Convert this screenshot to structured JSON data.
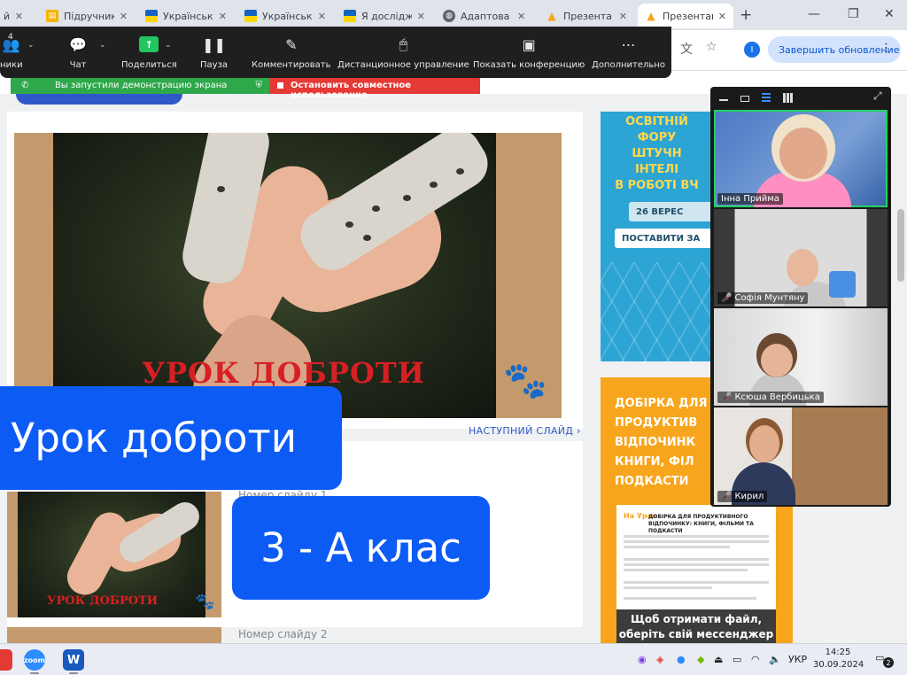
{
  "browser": {
    "tabs": [
      {
        "title": "й",
        "icon": "document-icon",
        "active": false
      },
      {
        "title": "Підручник",
        "icon": "book-icon",
        "active": false
      },
      {
        "title": "Українськ",
        "icon": "ukraine-flag-icon",
        "active": false
      },
      {
        "title": "Українськ",
        "icon": "ukraine-flag-icon",
        "active": false
      },
      {
        "title": "Я дослідж",
        "icon": "ukraine-flag-icon",
        "active": false
      },
      {
        "title": "Адаптова",
        "icon": "globe-icon",
        "active": false
      },
      {
        "title": "Презента",
        "icon": "naurok-icon",
        "active": false
      },
      {
        "title": "Презентац",
        "icon": "naurok-icon",
        "active": true
      }
    ],
    "profile_initial": "I",
    "update_button": "Завершить обновление"
  },
  "zoom_toolbar": {
    "participants_count": "4",
    "items": [
      {
        "label": "ники",
        "icon": "participants-icon"
      },
      {
        "label": "Чат",
        "icon": "chat-icon"
      },
      {
        "label": "Поделиться",
        "icon": "share-screen-icon"
      },
      {
        "label": "Пауза",
        "icon": "pause-icon"
      },
      {
        "label": "Комментировать",
        "icon": "pencil-icon"
      },
      {
        "label": "Дистанционное управление",
        "icon": "mouse-icon"
      },
      {
        "label": "Показать конференцию",
        "icon": "show-meeting-icon"
      },
      {
        "label": "Дополнительно",
        "icon": "more-icon"
      }
    ]
  },
  "share_banner": {
    "status": "Вы запустили демонстрацию экрана",
    "stop": "Остановить совместное использование"
  },
  "page": {
    "slide_title": "УРОК ДОБРОТИ",
    "next_slide": "НАСТУПНИЙ СЛАЙД ›",
    "slide_number_1": "Номер слайду 1",
    "slide_number_2": "Номер слайду 2"
  },
  "ads": {
    "ad1_lines": [
      "ОСВІТНІЙ",
      "ФОРУ",
      "ШТУЧН",
      "ІНТЕЛІ",
      "В РОБОТІ ВЧ"
    ],
    "ad1_date": "26 ВЕРЕС",
    "ad1_cta": "ПОСТАВИТИ ЗА",
    "ad2_lines": [
      "ДОБІРКА ДЛЯ",
      "ПРОДУКТИВ",
      "ВІДПОЧИНК",
      "КНИГИ, ФІЛ",
      "ПОДКАСТИ"
    ],
    "ad2_doc_logo": "На Урок",
    "ad2_doc_title": "ДОБІРКА ДЛЯ ПРОДУКТИВНОГО ВІДПОЧИНКУ: КНИГИ, ФІЛЬМИ ТА ПОДКАСТИ",
    "ad2_dark_lines": [
      "Щоб отримати файл,",
      "оберіть свій мессенджер"
    ]
  },
  "gallery": {
    "participants": [
      {
        "name": "Інна Прийма",
        "muted": false,
        "speaking": true
      },
      {
        "name": "Софія Мунтяну",
        "muted": true,
        "speaking": false
      },
      {
        "name": "Ксюша Вербицька",
        "muted": true,
        "speaking": false
      },
      {
        "name": "Кирил",
        "muted": true,
        "speaking": false
      }
    ]
  },
  "overlay": {
    "lesson": "Урок доброти",
    "class": "3 - А клас"
  },
  "taskbar": {
    "apps": [
      {
        "name": "zoom",
        "icon": "zoom-app-icon",
        "color": "#2d8cff"
      },
      {
        "name": "W",
        "icon": "word-app-icon",
        "color": "#185abd"
      }
    ],
    "language": "УКР",
    "time": "14:25",
    "date": "30.09.2024",
    "notifications": "2"
  }
}
